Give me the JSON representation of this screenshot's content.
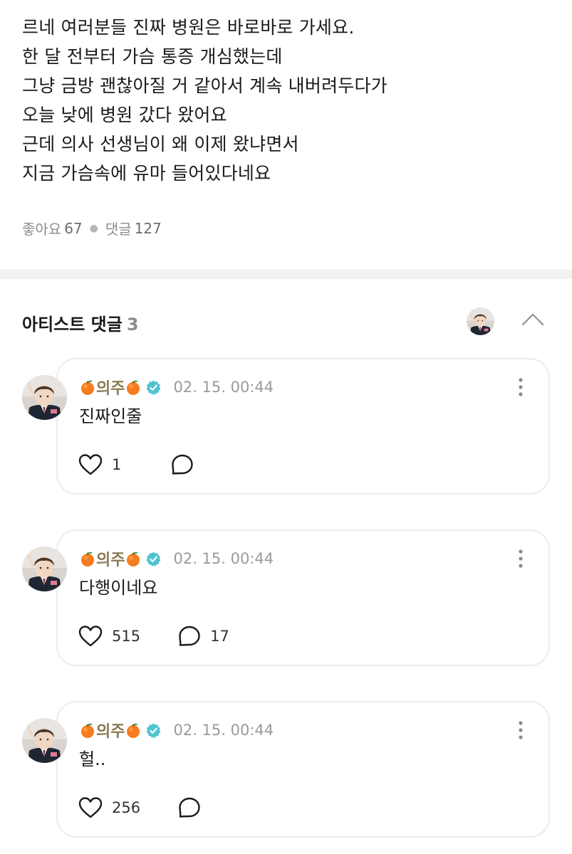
{
  "post": {
    "lines": [
      "르네 여러분들 진짜 병원은 바로바로 가세요.",
      "한 달 전부터 가슴 통증 개심했는데",
      "그냥 금방 괜찮아질 거 같아서 계속 내버려두다가",
      "오늘 낮에 병원 갔다 왔어요",
      "근데 의사 선생님이 왜 이제 왔냐면서",
      "지금 가슴속에 유마 들어있다네요"
    ],
    "likes_label": "좋아요",
    "likes_count": "67",
    "comments_label": "댓글",
    "comments_count": "127"
  },
  "artist_comments": {
    "title": "아티스트 댓글",
    "count": "3"
  },
  "comments": [
    {
      "author": "의주",
      "time": "02. 15. 00:44",
      "text": "진짜인줄",
      "likes": "1",
      "replies": ""
    },
    {
      "author": "의주",
      "time": "02. 15. 00:44",
      "text": "다행이네요",
      "likes": "515",
      "replies": "17"
    },
    {
      "author": "의주",
      "time": "02. 15. 00:44",
      "text": "헐..",
      "likes": "256",
      "replies": ""
    }
  ],
  "icons": {
    "verified": "verified-badge-icon",
    "more": "more-vertical-icon",
    "like": "heart-icon",
    "reply": "comment-bubble-icon",
    "collapse": "chevron-up-icon",
    "tangerine": "tangerine-emoji"
  },
  "colors": {
    "divider": "#f2f2f2",
    "card_border": "#ececec",
    "author": "#8c7a55",
    "verified": "#4fc3d1",
    "muted": "#8c8c8c"
  }
}
